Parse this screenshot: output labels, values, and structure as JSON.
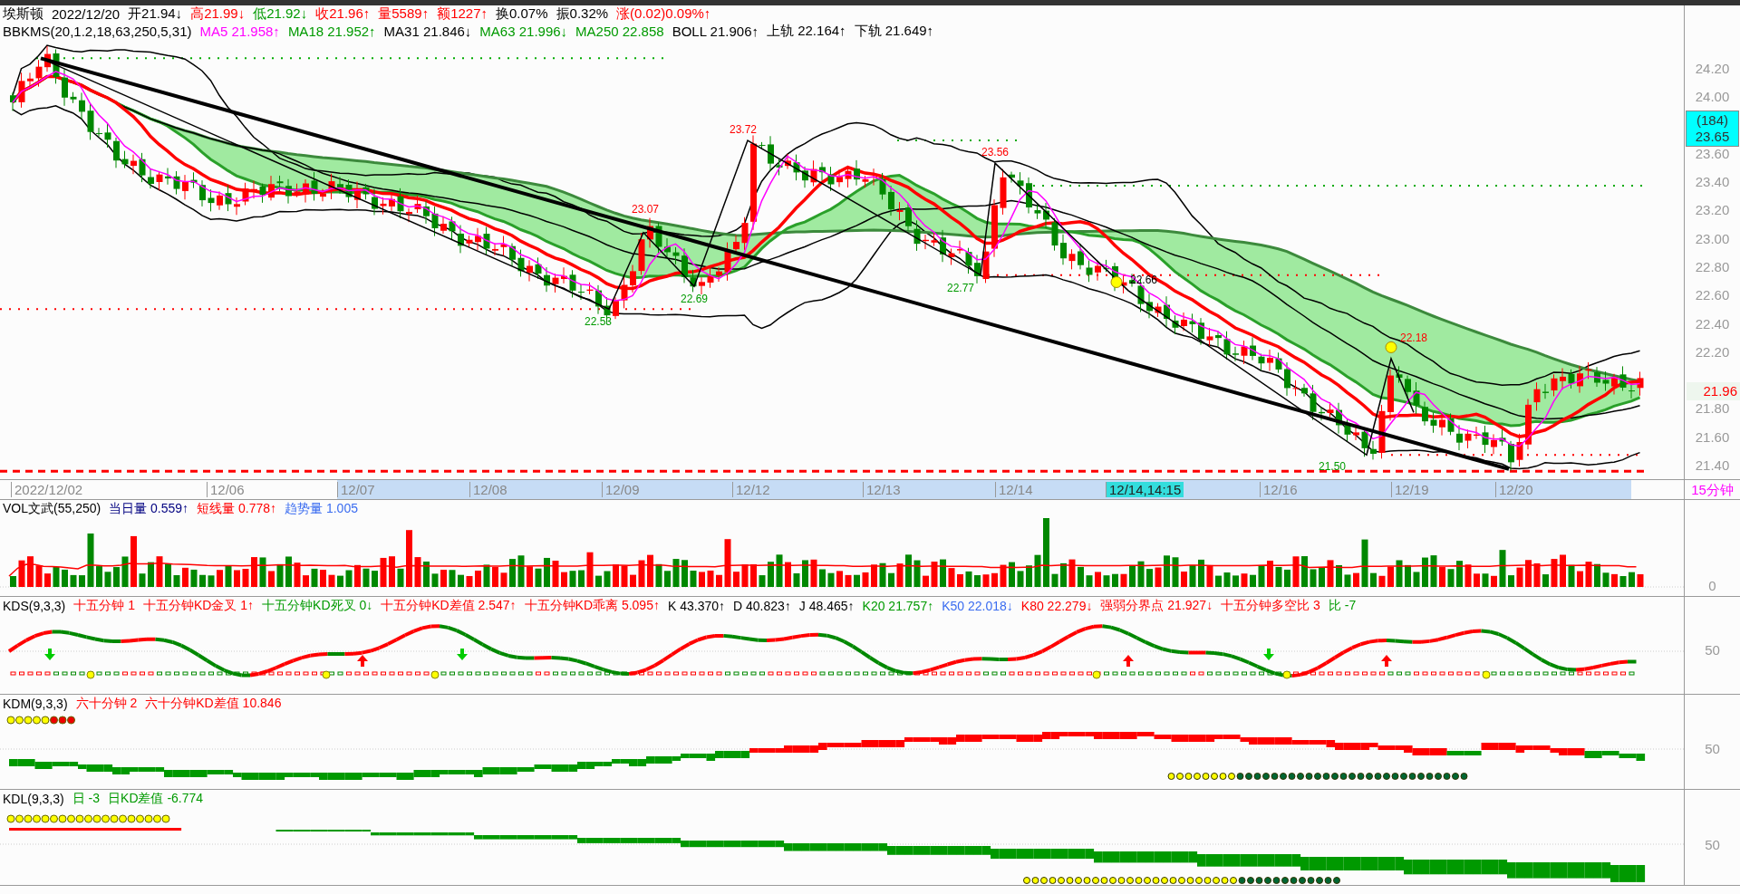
{
  "quote": [
    {
      "text": "埃斯顿",
      "color": "#000000"
    },
    {
      "text": "2022/12/20",
      "color": "#000000"
    },
    {
      "text": "开21.94↓",
      "color": "#000000"
    },
    {
      "text": "高21.99↓",
      "color": "#ff0000"
    },
    {
      "text": "低21.92↓",
      "color": "#009a00"
    },
    {
      "text": "收21.96↑",
      "color": "#ff0000"
    },
    {
      "text": "量5589↑",
      "color": "#ff0000"
    },
    {
      "text": "额1227↑",
      "color": "#ff0000"
    },
    {
      "text": "换0.07%",
      "color": "#000000"
    },
    {
      "text": "振0.32%",
      "color": "#000000"
    },
    {
      "text": "涨(0.02)0.09%↑",
      "color": "#ff0000"
    }
  ],
  "main_indicator": [
    {
      "text": "BBKMS(20,1.2,18,63,250,5,31)",
      "color": "#000000"
    },
    {
      "text": "MA5 21.958↑",
      "color": "#ff00ff"
    },
    {
      "text": "MA18 21.952↑",
      "color": "#009a00"
    },
    {
      "text": "MA31 21.846↓",
      "color": "#000000"
    },
    {
      "text": "MA63 21.996↓",
      "color": "#009a00"
    },
    {
      "text": "MA250 22.858",
      "color": "#009a00"
    },
    {
      "text": "BOLL 21.906↑",
      "color": "#000000"
    },
    {
      "text": "上轨 22.164↑",
      "color": "#000000"
    },
    {
      "text": "下轨 21.649↑",
      "color": "#000000"
    }
  ],
  "price_labels": [
    {
      "text": "23.72",
      "color": "#ff0000"
    },
    {
      "text": "23.07",
      "color": "#ff0000"
    },
    {
      "text": "22.53",
      "color": "#009a00"
    },
    {
      "text": "22.69",
      "color": "#009a00"
    },
    {
      "text": "23.56",
      "color": "#ff0000"
    },
    {
      "text": "22.77",
      "color": "#009a00"
    },
    {
      "text": "22.66",
      "color": "#000000"
    },
    {
      "text": "22.18",
      "color": "#ff0000"
    },
    {
      "text": "21.50",
      "color": "#009a00"
    }
  ],
  "price_axis": {
    "ticks": [
      "24.20",
      "24.00",
      "23.60",
      "23.40",
      "23.20",
      "23.00",
      "22.80",
      "22.60",
      "22.40",
      "22.20",
      "21.80",
      "21.60",
      "21.40"
    ],
    "cursor_count": "(184)",
    "cursor_price": "23.65",
    "last_price": "21.96"
  },
  "date_axis": {
    "labels": [
      {
        "text": "2022/12/02",
        "selected": false
      },
      {
        "text": "12/06",
        "selected": false
      },
      {
        "text": "12/07",
        "selected": false
      },
      {
        "text": "12/08",
        "selected": false
      },
      {
        "text": "12/09",
        "selected": false
      },
      {
        "text": "12/12",
        "selected": false
      },
      {
        "text": "12/13",
        "selected": false
      },
      {
        "text": "12/14",
        "selected": false
      },
      {
        "text": "12/14,14:15",
        "selected": true
      },
      {
        "text": "12/16",
        "selected": false
      },
      {
        "text": "12/19",
        "selected": false
      },
      {
        "text": "12/20",
        "selected": false
      }
    ],
    "period": "15分钟"
  },
  "panels": [
    {
      "kind": "vol",
      "axis_label": "0",
      "items": [
        {
          "text": "VOL文武(55,250)",
          "color": "#000000"
        },
        {
          "text": "当日量 0.559↑",
          "color": "#000080"
        },
        {
          "text": "短线量 0.778↑",
          "color": "#ff0000"
        },
        {
          "text": "趋势量 1.005",
          "color": "#3a6cf0"
        }
      ]
    },
    {
      "kind": "kds",
      "axis_label": "50",
      "items": [
        {
          "text": "KDS(9,3,3)",
          "color": "#000000"
        },
        {
          "text": "十五分钟 1",
          "color": "#ff0000"
        },
        {
          "text": "十五分钟KD金叉 1↑",
          "color": "#ff0000"
        },
        {
          "text": "十五分钟KD死叉 0↓",
          "color": "#009a00"
        },
        {
          "text": "十五分钟KD差值 2.547↑",
          "color": "#ff0000"
        },
        {
          "text": "十五分钟KD乖离 5.095↑",
          "color": "#ff0000"
        },
        {
          "text": "K 43.370↑",
          "color": "#000000"
        },
        {
          "text": "D 40.823↑",
          "color": "#000000"
        },
        {
          "text": "J 48.465↑",
          "color": "#000000"
        },
        {
          "text": "K20 21.757↑",
          "color": "#009a00"
        },
        {
          "text": "K50 22.018↓",
          "color": "#3a6cf0"
        },
        {
          "text": "K80 22.279↓",
          "color": "#ff0000"
        },
        {
          "text": "强弱分界点 21.927↓",
          "color": "#ff0000"
        },
        {
          "text": "十五分钟多空比 3",
          "color": "#ff0000"
        },
        {
          "text": "比 -7",
          "color": "#009a00"
        }
      ]
    },
    {
      "kind": "kdm",
      "axis_label": "50",
      "items": [
        {
          "text": "KDM(9,3,3)",
          "color": "#000000"
        },
        {
          "text": "六十分钟 2",
          "color": "#ff0000"
        },
        {
          "text": "六十分钟KD差值 10.846",
          "color": "#ff0000"
        }
      ]
    },
    {
      "kind": "kdl",
      "axis_label": "50",
      "items": [
        {
          "text": "KDL(9,3,3)",
          "color": "#000000"
        },
        {
          "text": "日 -3",
          "color": "#009a00"
        },
        {
          "text": "日KD差值 -6.774",
          "color": "#009a00"
        }
      ]
    }
  ]
}
